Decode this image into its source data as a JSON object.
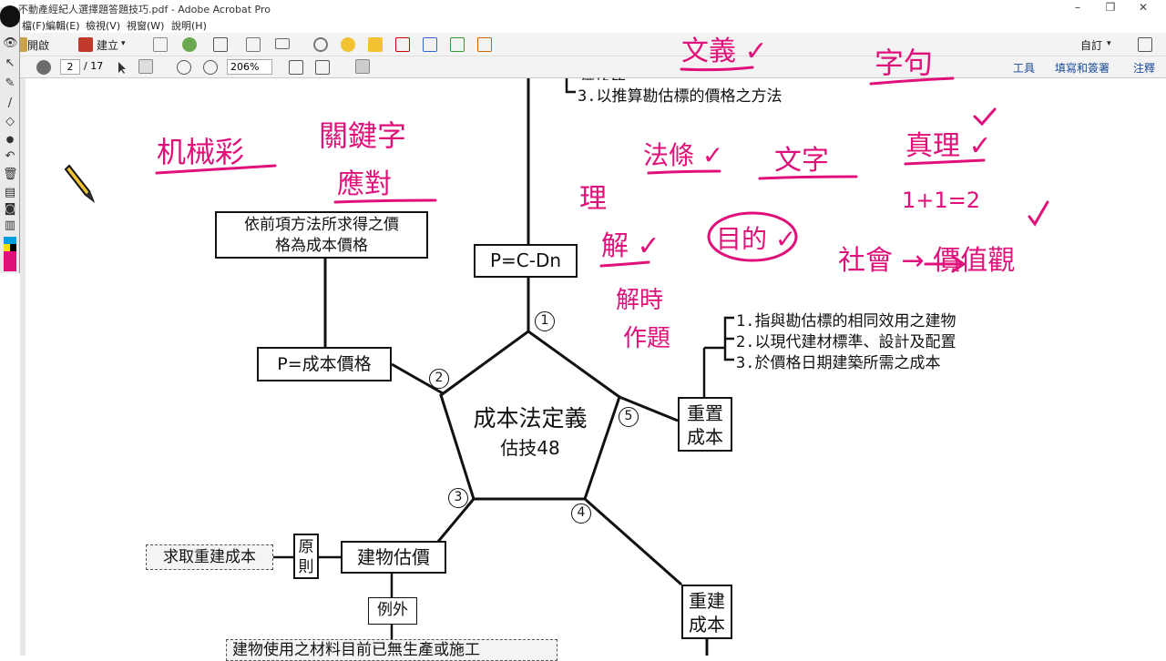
{
  "window": {
    "title": "不動產經紀人選擇題答題技巧.pdf - Adobe Acrobat Pro",
    "minimize": "–",
    "restore": "❐",
    "close": "✕"
  },
  "menu": [
    "檔(F)",
    "編輯(E)",
    "檢視(V)",
    "視窗(W)",
    "說明(H)"
  ],
  "toolbar": {
    "open_label": "開啟",
    "create_label": "建立",
    "customize_label": "自訂",
    "dropdown_glyph": "▾"
  },
  "nav": {
    "page_value": "2",
    "page_total": "/ 17",
    "zoom_value": "206%",
    "tools_label": "工具",
    "fill_sign_label": "填寫和簽署",
    "comment_label": "注釋"
  },
  "document": {
    "top_partial": "價格等",
    "top_item3": "3.以推算勘估標的價格之方法",
    "box_define_line1": "依前項方法所求得之價",
    "box_define_line2": "格為成本價格",
    "box_pcdn": "P=C-Dn",
    "box_pcost": "P=成本價格",
    "center_title": "成本法定義",
    "center_sub": "估技48",
    "num1": "1",
    "num2": "2",
    "num3": "3",
    "num4": "4",
    "num5": "5",
    "replace_line1": "重置",
    "replace_line2": "成本",
    "list_1": "1.指與勘估標的相同效用之建物",
    "list_2": "2.以現代建材標準、設計及配置",
    "list_3": "3.於價格日期建築所需之成本",
    "rebuild_line1": "重建",
    "rebuild_line2": "成本",
    "building_box": "建物估價",
    "principle_line1": "原",
    "principle_line2": "則",
    "seek_rebuild": "求取重建成本",
    "exception": "例外",
    "bottom_partial": "建物使用之材料目前已無生產或施工"
  },
  "handwriting": {
    "h1": "文義 ✓",
    "h2": "字句",
    "h3": "机械彩",
    "h4": "關鍵字",
    "h5": "應對",
    "h6": "法條 ✓",
    "h7": "文字",
    "h8": "真理 ✓",
    "h9": "理",
    "h10": "解 ✓",
    "h11": "目的 ✓",
    "h12": "1+1=2",
    "h13": "社會 → 價值觀",
    "h14": "解時",
    "h15": "作題"
  },
  "colors": {
    "ink": "#e0107a",
    "toolbar_bg": "#f3f3f3",
    "link_blue": "#1a4a9a"
  }
}
